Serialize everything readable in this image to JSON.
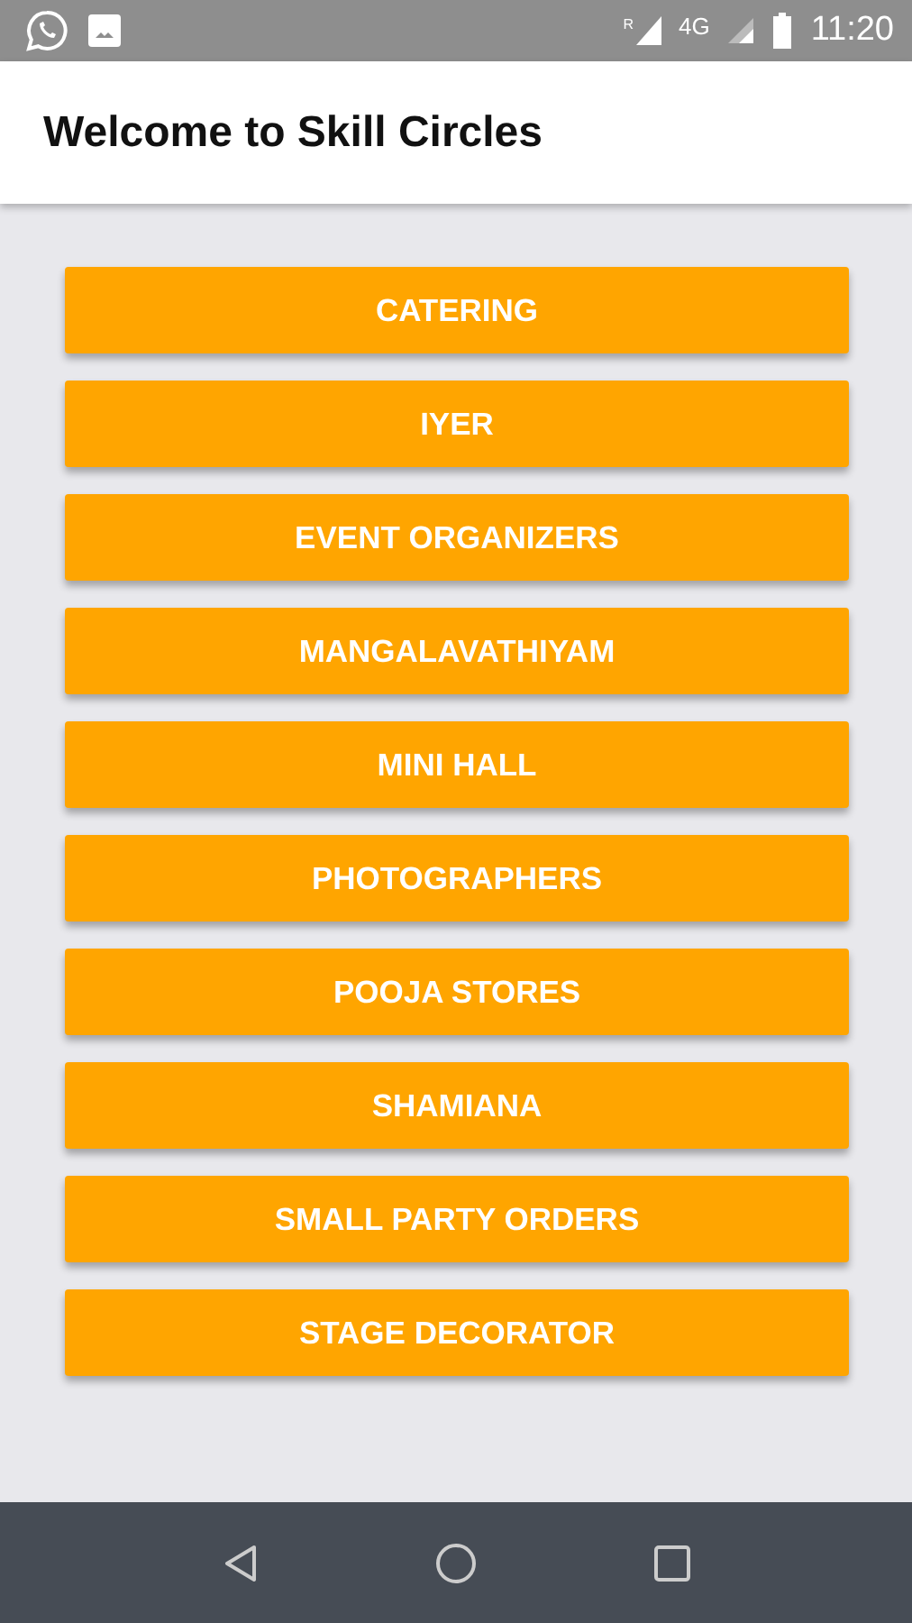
{
  "status_bar": {
    "roaming": "R",
    "network": "4G",
    "time": "11:20"
  },
  "app_bar": {
    "title": "Welcome to Skill Circles"
  },
  "categories": [
    {
      "label": "CATERING"
    },
    {
      "label": "IYER"
    },
    {
      "label": "EVENT ORGANIZERS"
    },
    {
      "label": "MANGALAVATHIYAM"
    },
    {
      "label": "MINI HALL"
    },
    {
      "label": "PHOTOGRAPHERS"
    },
    {
      "label": "POOJA STORES"
    },
    {
      "label": "SHAMIANA"
    },
    {
      "label": "SMALL PARTY ORDERS"
    },
    {
      "label": "STAGE DECORATOR"
    }
  ]
}
